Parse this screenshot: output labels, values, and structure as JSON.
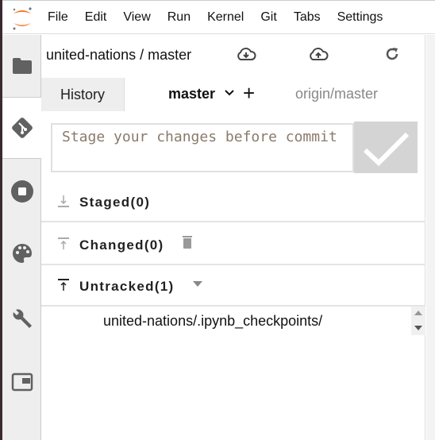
{
  "menu": {
    "items": [
      "File",
      "Edit",
      "View",
      "Run",
      "Kernel",
      "Git",
      "Tabs",
      "Settings"
    ]
  },
  "sidebar": {
    "items": [
      {
        "icon": "folder-icon"
      },
      {
        "icon": "git-icon",
        "active": true
      },
      {
        "icon": "stop-circle-icon"
      },
      {
        "icon": "palette-icon"
      },
      {
        "icon": "wrench-icon"
      },
      {
        "icon": "tab-window-icon"
      }
    ]
  },
  "git": {
    "repo_label": "united-nations / master",
    "toolbar": {
      "pull": "cloud-download-icon",
      "push": "cloud-upload-icon",
      "refresh": "refresh-icon"
    },
    "tabs": {
      "history": "History",
      "branch": "master",
      "origin": "origin/master"
    },
    "commit": {
      "placeholder": "Stage your changes before commit",
      "value": ""
    },
    "sections": {
      "staged": "Staged(0)",
      "changed": "Changed(0)",
      "untracked": "Untracked(1)"
    },
    "untracked_files": [
      "united-nations/.ipynb_checkpoints/"
    ]
  },
  "colors": {
    "accent": "#f37726",
    "sidebar_bg": "#eeeeee",
    "commit_button": "#d4d4d4"
  }
}
